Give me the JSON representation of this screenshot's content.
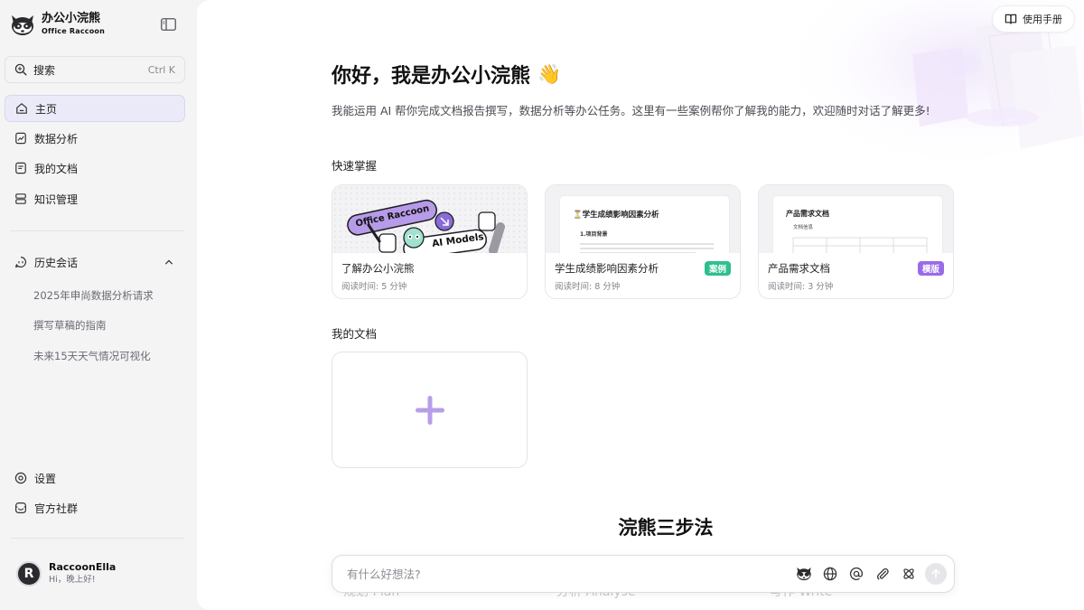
{
  "brand": {
    "name": "办公小浣熊",
    "subtitle": "Office Raccoon"
  },
  "search": {
    "label": "搜索",
    "shortcut": "Ctrl K"
  },
  "nav": {
    "home": "主页",
    "data_analysis": "数据分析",
    "my_docs": "我的文档",
    "knowledge": "知识管理"
  },
  "history": {
    "title": "历史会话",
    "items": [
      "2025年申尚数据分析请求",
      "撰写草稿的指南",
      "未来15天天气情况可视化"
    ]
  },
  "bottom_nav": {
    "settings": "设置",
    "community": "官方社群"
  },
  "user": {
    "initial": "R",
    "name": "RaccoonElla",
    "greeting": "Hi，晚上好!"
  },
  "header": {
    "manual": "使用手册"
  },
  "welcome": {
    "title": "你好，我是办公小浣熊",
    "emoji": "👋",
    "intro": "我能运用 AI 帮你完成文档报告撰写，数据分析等办公任务。这里有一些案例帮你了解我的能力，欢迎随时对话了解更多!"
  },
  "quick_start": {
    "title": "快速掌握",
    "cards": [
      {
        "title": "了解办公小浣熊",
        "meta": "阅读时间: 5 分钟",
        "tag": "",
        "thumb_pill1": "Office Raccoon",
        "thumb_pill2": "AI Models"
      },
      {
        "title": "学生成绩影响因素分析",
        "meta": "阅读时间: 8 分钟",
        "tag": "案例",
        "tag_color": "#2fbf8f",
        "thumb_title": "⏳学生成绩影响因素分析",
        "thumb_sub": "1.项目背景"
      },
      {
        "title": "产品需求文档",
        "meta": "阅读时间: 3 分钟",
        "tag": "模版",
        "tag_color": "#9a6be8",
        "thumb_title": "产品需求文档",
        "thumb_sub": "文档信息"
      }
    ]
  },
  "my_docs": {
    "title": "我的文档"
  },
  "steps": {
    "title": "浣熊三步法",
    "faded": [
      "规划 Plan",
      "分析 Analyse",
      "写作 Write"
    ]
  },
  "chat": {
    "placeholder": "有什么好想法?"
  },
  "colors": {
    "accent": "#9b7fe0",
    "plus": "#b79ee8",
    "tag_case": "#2fbf8f",
    "tag_template": "#9a6be8"
  }
}
